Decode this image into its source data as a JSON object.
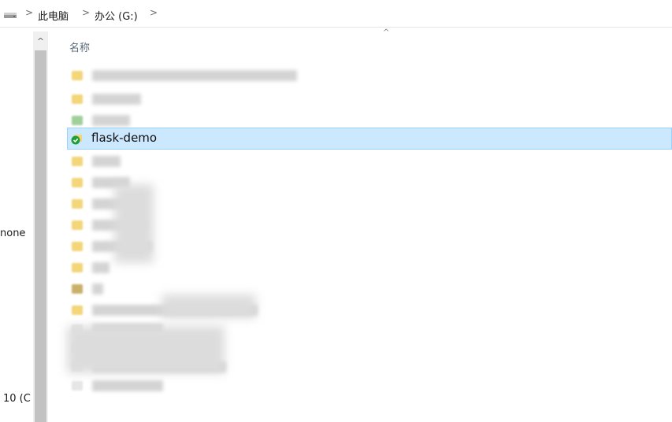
{
  "address_bar": {
    "separators": [
      ">",
      ">",
      ">"
    ],
    "crumbs": [
      "此电脑",
      "办公 (G:)"
    ]
  },
  "nav_pane": {
    "items": [
      "none",
      "10 (C"
    ],
    "scroll_up": "^"
  },
  "file_list": {
    "column_header": "名称",
    "sort_indicator": "^",
    "selected_item": "flask-demo"
  },
  "colors": {
    "selection_bg": "#cce8ff",
    "selection_border": "#99d1ff",
    "sync_ok": "#1e9e3a",
    "folder": "#f3d57a"
  }
}
